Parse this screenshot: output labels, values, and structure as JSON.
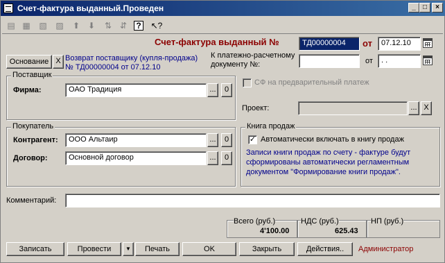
{
  "window": {
    "title": "Счет-фактура выданный.Проведен",
    "minimize": "_",
    "maximize": "□",
    "close": "×"
  },
  "toolbar": {
    "icons": [
      "copy-doc-icon",
      "new-doc-icon",
      "edit-doc-icon",
      "delete-doc-icon",
      "move-up-icon",
      "move-down-icon",
      "sort-asc-icon",
      "sort-desc-icon",
      "help-icon",
      "context-help-icon"
    ]
  },
  "header": {
    "title": "Счет-фактура выданный №",
    "number": "ТД00000004",
    "from_label": "от",
    "date": "07.12.10"
  },
  "basis": {
    "button_label": "Основание",
    "clear_label": "X",
    "link_line1": "Возврат поставщику (купля-продажа)",
    "link_line2": "№ ТД00000004 от 07.12.10"
  },
  "payment_doc": {
    "label_line1": "К платежно-расчетному",
    "label_line2": "документу №:",
    "number": "",
    "from_label": "от",
    "date": " .  ."
  },
  "supplier": {
    "legend": "Поставщик",
    "firm_label": "Фирма:",
    "firm_value": "ОАО Традиция"
  },
  "prepayment": {
    "label": "СФ на предварительный платеж"
  },
  "project": {
    "label": "Проект:",
    "value": ""
  },
  "buyer": {
    "legend": "Покупатель",
    "contractor_label": "Контрагент:",
    "contractor_value": "ООО Альтаир",
    "contract_label": "Договор:",
    "contract_value": "Основной договор"
  },
  "sales_book": {
    "legend": "Книга продаж",
    "auto_label": "Автоматически включать в книгу продаж",
    "note_line1": "Записи книги продаж по счету - фактуре будут",
    "note_line2": "сформированы автоматически регламентным",
    "note_line3": "документом \"Формирование книги продаж\"."
  },
  "comment": {
    "label": "Комментарий:",
    "value": ""
  },
  "totals": {
    "total_label": "Всего (руб.)",
    "total_value": "4'100.00",
    "vat_label": "НДС (руб.)",
    "vat_value": "625.43",
    "np_label": "НП (руб.)",
    "np_value": ""
  },
  "buttons": {
    "write": "Записать",
    "post": "Провести",
    "print": "Печать",
    "ok": "OK",
    "close": "Закрыть",
    "actions": "Действия..",
    "dots": "...",
    "zero": "0"
  },
  "user": "Администратор",
  "colors": {
    "title_start": "#0a246a",
    "title_end": "#3a6ea5",
    "heading": "#8b0000",
    "link": "#00008b",
    "user": "#8b0000",
    "background": "#d4d0c8"
  }
}
